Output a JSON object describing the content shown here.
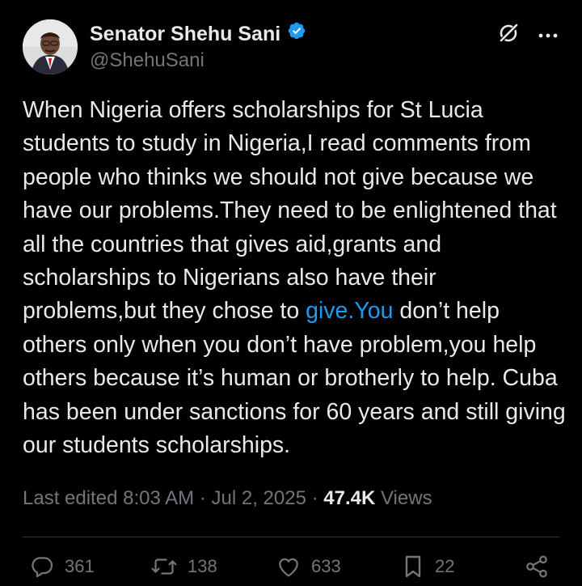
{
  "author": {
    "display_name": "Senator Shehu Sani",
    "handle": "@ShehuSani",
    "verified": true,
    "verified_color": "#1d9bf0"
  },
  "header_icons": [
    "grok-icon",
    "more-icon"
  ],
  "tweet": {
    "text_before_link": "When Nigeria offers scholarships for St Lucia students to study in Nigeria,I read comments from people who thinks we should not give because we have our problems.They need to be enlightened that all the countries that gives aid,grants and scholarships to Nigerians also have their problems,but they chose to ",
    "link_text": "give.You",
    "text_after_link": " don’t help others only when you don’t have problem,you help others because it’s human or brotherly to help. Cuba has been under sanctions for 60 years and still giving our students scholarships."
  },
  "meta": {
    "edited_label": "Last edited",
    "time": "8:03 AM",
    "separator": "·",
    "date": "Jul 2, 2025",
    "views_count": "47.4K",
    "views_label": "Views"
  },
  "engagement": {
    "replies": "361",
    "reposts": "138",
    "likes": "633",
    "bookmarks": "22"
  },
  "colors": {
    "background": "#000000",
    "text": "#e7e9ea",
    "secondary": "#71767b",
    "link": "#1d9bf0"
  }
}
